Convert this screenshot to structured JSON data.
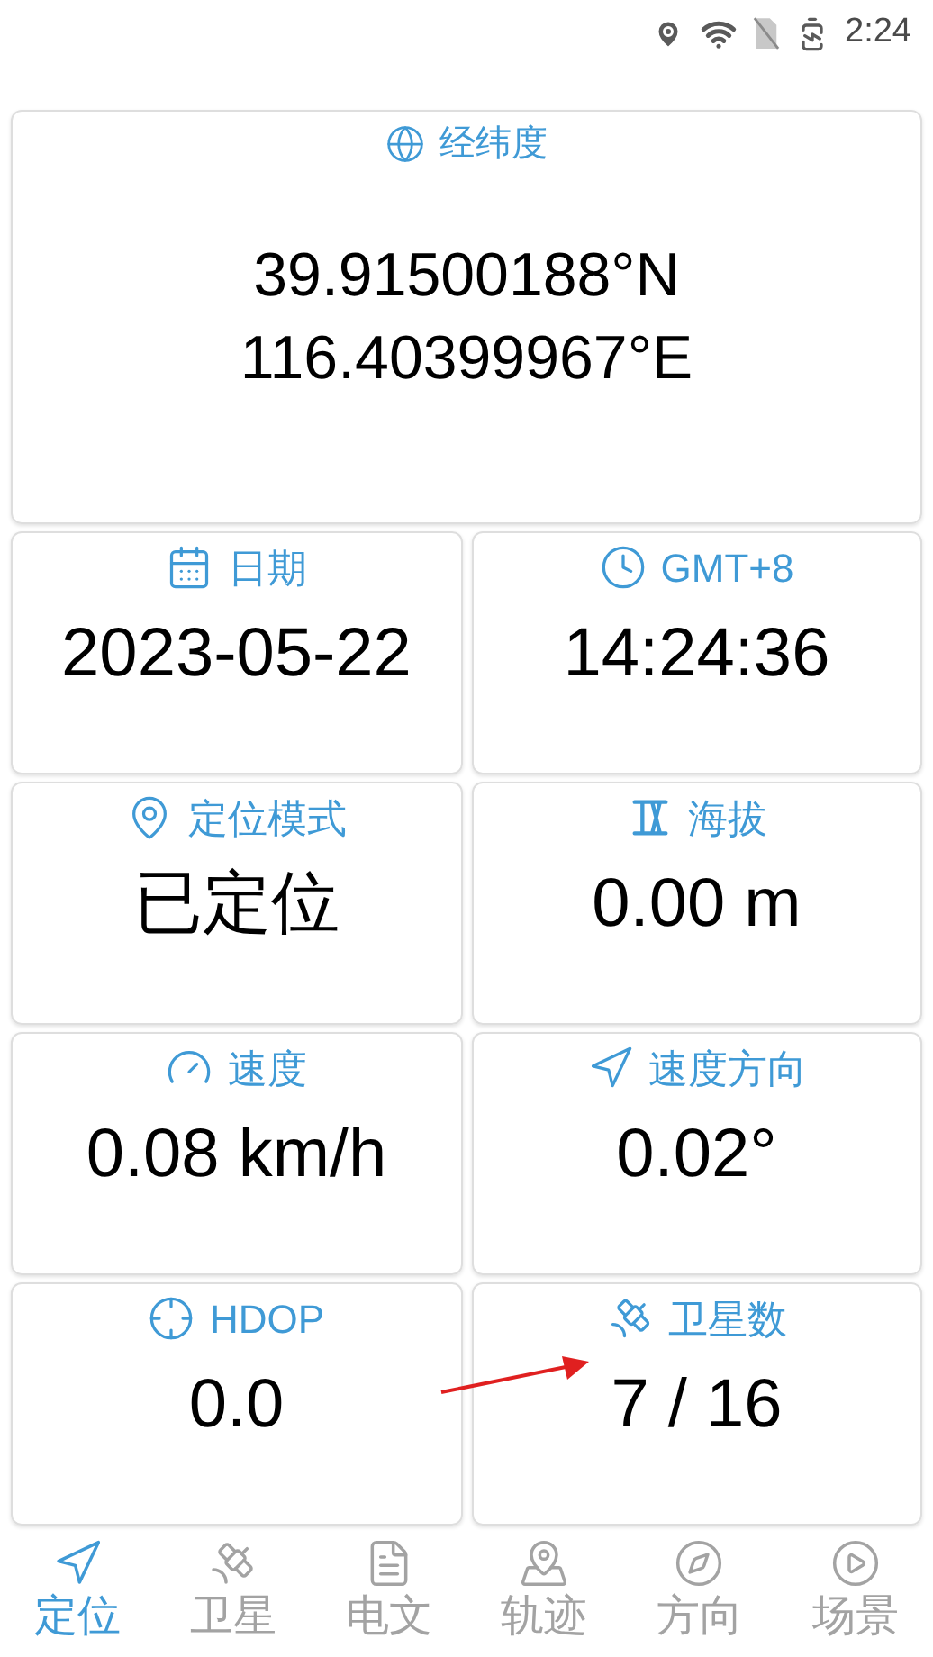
{
  "status_bar": {
    "time": "2:24"
  },
  "coordinates": {
    "label": "经纬度",
    "lines": [
      "39.91500188°N",
      "116.40399967°E"
    ]
  },
  "cards": [
    {
      "label": "日期",
      "value": "2023-05-22"
    },
    {
      "label": "GMT+8",
      "value": "14:24:36"
    },
    {
      "label": "定位模式",
      "value": "已定位"
    },
    {
      "label": "海拔",
      "value": "0.00 m"
    },
    {
      "label": "速度",
      "value": "0.08 km/h"
    },
    {
      "label": "速度方向",
      "value": "0.02°"
    },
    {
      "label": "HDOP",
      "value": "0.0"
    },
    {
      "label": "卫星数",
      "value": "7 / 16"
    }
  ],
  "bottom_nav": [
    {
      "label": "定位",
      "selected": true
    },
    {
      "label": "卫星",
      "selected": false
    },
    {
      "label": "电文",
      "selected": false
    },
    {
      "label": "轨迹",
      "selected": false
    },
    {
      "label": "方向",
      "selected": false
    },
    {
      "label": "场景",
      "selected": false
    }
  ]
}
